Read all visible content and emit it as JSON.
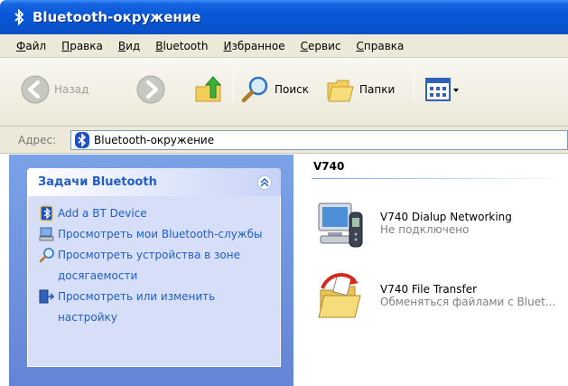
{
  "window": {
    "title": "Bluetooth-окружение"
  },
  "menu": [
    {
      "first": "Ф",
      "rest": "айл"
    },
    {
      "first": "П",
      "rest": "равка"
    },
    {
      "first": "В",
      "rest": "ид"
    },
    {
      "first": "B",
      "rest": "luetooth"
    },
    {
      "first": "И",
      "rest": "збранное"
    },
    {
      "first": "С",
      "rest": "ервис"
    },
    {
      "first": "С",
      "rest": "правка"
    }
  ],
  "toolbar": {
    "back_label": "Назад",
    "search_label": "Поиск",
    "folders_label": "Папки"
  },
  "address": {
    "label": "Адрес:",
    "value": "Bluetooth-окружение"
  },
  "tasks": {
    "title": "Задачи Bluetooth",
    "items": [
      "Add a BT Device",
      "Просмотреть мои Bluetooth-службы",
      "Просмотреть устройства в зоне досягаемости",
      "Просмотреть или изменить настройку"
    ]
  },
  "group": {
    "name": "V740",
    "services": [
      {
        "name": "V740 Dialup Networking",
        "desc": "Не подключено"
      },
      {
        "name": "V740 File Transfer",
        "desc": "Обменяться файлами с Bluet..."
      }
    ]
  },
  "colors": {
    "titlebar": "#0a58d8",
    "link": "#215dc6",
    "taskpane": "#6f93dc"
  }
}
